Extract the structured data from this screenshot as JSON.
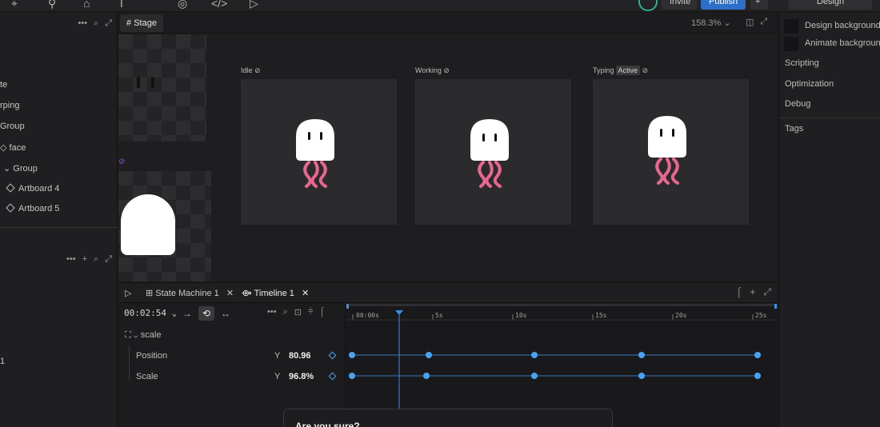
{
  "topbar": {
    "tools": [
      "⌖",
      "⚲",
      "⌂",
      "I",
      "◎",
      "</>",
      "▷"
    ],
    "invite_label": "Invite",
    "publish_label": "Publish",
    "more_label": "+",
    "design_label": "Design"
  },
  "left_panel": {
    "header_icons": [
      "•••",
      "⌕",
      "⤢"
    ],
    "items": [
      {
        "label": "te"
      },
      {
        "label": "rping"
      },
      {
        "label": "Group"
      },
      {
        "label": "face"
      },
      {
        "label": "Group"
      },
      {
        "label": "Artboard 4"
      },
      {
        "label": "Artboard 5"
      }
    ],
    "bottom_header_icons": [
      "•••",
      "+",
      "⌕",
      "⤢"
    ],
    "bottom_item": "1"
  },
  "stage": {
    "tab_label": "Stage",
    "zoom": "158.3%",
    "artboards": [
      {
        "name": "Idle",
        "badge": ""
      },
      {
        "name": "Working",
        "badge": ""
      },
      {
        "name": "Typing",
        "badge": "Active"
      }
    ]
  },
  "timeline": {
    "tabs": [
      {
        "label": "State Machine 1"
      },
      {
        "label": "Timeline 1"
      }
    ],
    "time": "00:02:54",
    "group_label": "scale",
    "rows": [
      {
        "label": "Position",
        "axis": "Y",
        "value": "80.96"
      },
      {
        "label": "Scale",
        "axis": "Y",
        "value": "96.8%"
      }
    ],
    "ruler_labels": [
      "00:00s",
      "5s",
      "10s",
      "15s",
      "20s",
      "25s"
    ]
  },
  "right_panel": {
    "design_background": "Design background",
    "animate_background": "Animate background",
    "sections": [
      "Scripting",
      "Optimization",
      "Debug"
    ],
    "tags_label": "Tags"
  },
  "dialog": {
    "title": "Are you sure?"
  },
  "colors": {
    "accent": "#2d6ec9",
    "keyframe": "#4aa3f0",
    "tentacle": "#e9668f"
  }
}
